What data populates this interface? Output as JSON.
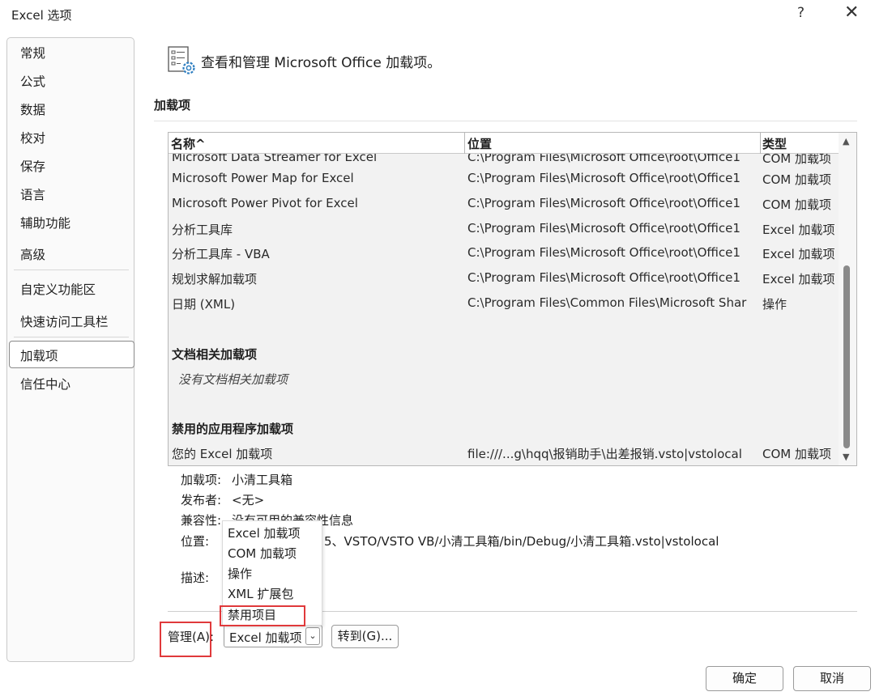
{
  "window": {
    "title": "Excel 选项",
    "help": "?",
    "close": "✕"
  },
  "sidebar": {
    "items": [
      {
        "label": "常规"
      },
      {
        "label": "公式"
      },
      {
        "label": "数据"
      },
      {
        "label": "校对"
      },
      {
        "label": "保存"
      },
      {
        "label": "语言"
      },
      {
        "label": "辅助功能"
      },
      {
        "label": "高级"
      },
      {
        "label": "自定义功能区"
      },
      {
        "label": "快速访问工具栏"
      },
      {
        "label": "加载项",
        "selected": true
      },
      {
        "label": "信任中心"
      }
    ]
  },
  "header": {
    "text": "查看和管理 Microsoft Office 加载项。",
    "icon": "addins-gear-icon"
  },
  "section": {
    "title": "加载项"
  },
  "table": {
    "columns": [
      "名称^",
      "位置",
      "类型"
    ],
    "partial_row": {
      "name": "Microsoft Data Streamer for Excel",
      "location": "C:\\Program Files\\Microsoft Office\\root\\Office1",
      "type": "COM 加载项"
    },
    "rows": [
      {
        "name": "Microsoft Power Map for Excel",
        "location": "C:\\Program Files\\Microsoft Office\\root\\Office1",
        "type": "COM 加载项"
      },
      {
        "name": "Microsoft Power Pivot for Excel",
        "location": "C:\\Program Files\\Microsoft Office\\root\\Office1",
        "type": "COM 加载项"
      },
      {
        "name": "分析工具库",
        "location": "C:\\Program Files\\Microsoft Office\\root\\Office1",
        "type": "Excel 加载项"
      },
      {
        "name": "分析工具库 - VBA",
        "location": "C:\\Program Files\\Microsoft Office\\root\\Office1",
        "type": "Excel 加载项"
      },
      {
        "name": "规划求解加载项",
        "location": "C:\\Program Files\\Microsoft Office\\root\\Office1",
        "type": "Excel 加载项"
      },
      {
        "name": "日期 (XML)",
        "location": "C:\\Program Files\\Common Files\\Microsoft Shar",
        "type": "操作"
      }
    ],
    "doc_group": {
      "title": "文档相关加载项",
      "empty": "没有文档相关加载项"
    },
    "disabled_group": {
      "title": "禁用的应用程序加载项",
      "rows": [
        {
          "name": "您的 Excel 加载项",
          "location": "file:///...g\\hqq\\报销助手\\出差报销.vsto|vstolocal",
          "type": "COM 加载项"
        }
      ]
    }
  },
  "details": {
    "addin_label": "加载项:",
    "addin_value": "小清工具箱",
    "publisher_label": "发布者:",
    "publisher_value": "<无>",
    "compat_label": "兼容性:",
    "compat_value": "没有可用的兼容性信息",
    "location_label": "位置:",
    "location_value": "5、VSTO/VSTO VB/小清工具箱/bin/Debug/小清工具箱.vsto|vstolocal",
    "desc_label": "描述:"
  },
  "dropdown": {
    "options": [
      "Excel 加载项",
      "COM 加载项",
      "操作",
      "XML 扩展包",
      "禁用项目"
    ]
  },
  "manage": {
    "label": "管理(A):",
    "selected": "Excel 加载项",
    "goto": "转到(G)..."
  },
  "buttons": {
    "ok": "确定",
    "cancel": "取消"
  },
  "colors": {
    "highlight_box": "#e0393b"
  }
}
